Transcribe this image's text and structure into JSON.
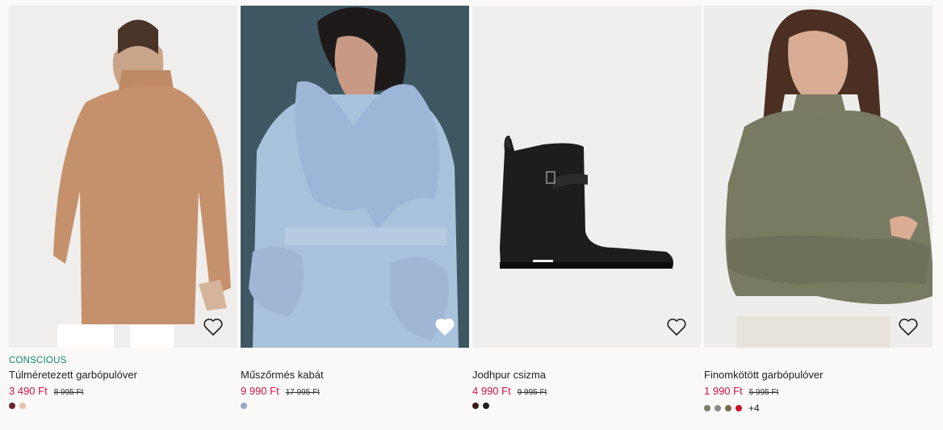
{
  "products": [
    {
      "tag": "CONSCIOUS",
      "title": "Túlméretezett garbópulóver",
      "price": "3 490 Ft",
      "old_price": "8 995 Ft",
      "swatches": [
        "#6b2330",
        "#e6c2ae"
      ],
      "more": ""
    },
    {
      "tag": "",
      "title": "Műszőrmés kabát",
      "price": "9 990 Ft",
      "old_price": "17 995 Ft",
      "swatches": [
        "#9aa8c0"
      ],
      "more": ""
    },
    {
      "tag": "",
      "title": "Jodhpur csizma",
      "price": "4 990 Ft",
      "old_price": "9 995 Ft",
      "swatches": [
        "#3b1c1c",
        "#1e1e1e"
      ],
      "more": ""
    },
    {
      "tag": "",
      "title": "Finomkötött garbópulóver",
      "price": "1 990 Ft",
      "old_price": "5 995 Ft",
      "swatches": [
        "#7b7e66",
        "#8a8a8a",
        "#7a6a4a",
        "#c8102e"
      ],
      "more": "+4"
    }
  ]
}
